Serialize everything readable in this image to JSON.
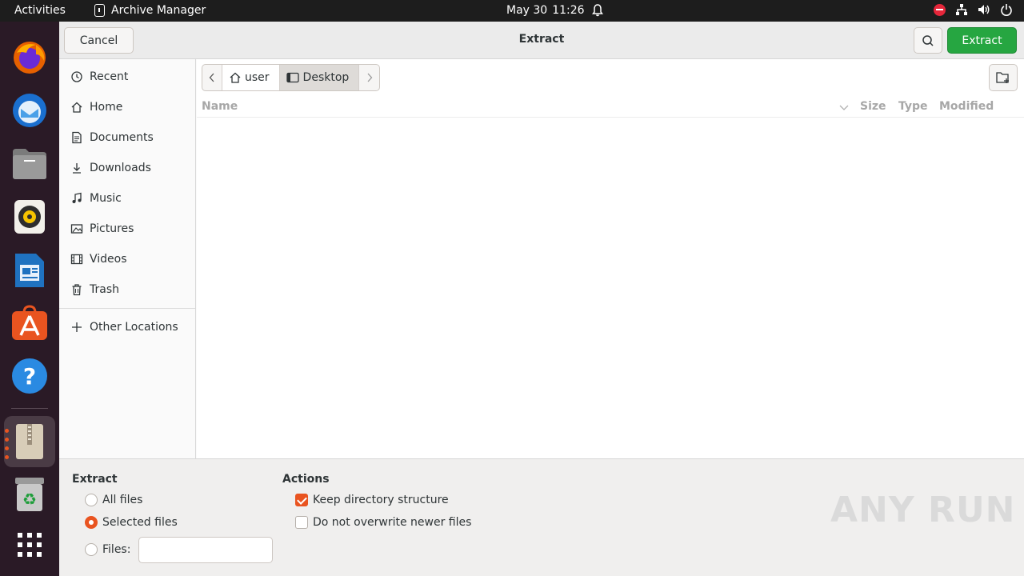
{
  "topbar": {
    "activities": "Activities",
    "app_name": "Archive Manager",
    "date": "May 30",
    "time": "11:26"
  },
  "dock": {
    "apps": [
      "firefox-icon",
      "thunderbird-icon",
      "files-icon",
      "rhythmbox-icon",
      "libreoffice-writer-icon",
      "app-center-icon",
      "help-icon",
      "archive-manager-icon",
      "trash-icon",
      "show-apps-icon"
    ],
    "active_app": "archive-manager-icon"
  },
  "dialog": {
    "title": "Extract",
    "cancel_label": "Cancel",
    "extract_label": "Extract"
  },
  "sidebar": {
    "items": [
      {
        "label": "Recent"
      },
      {
        "label": "Home"
      },
      {
        "label": "Documents"
      },
      {
        "label": "Downloads"
      },
      {
        "label": "Music"
      },
      {
        "label": "Pictures"
      },
      {
        "label": "Videos"
      },
      {
        "label": "Trash"
      }
    ],
    "other_locations": "Other Locations"
  },
  "pathbar": {
    "segments": [
      "user",
      "Desktop"
    ],
    "current": "Desktop"
  },
  "columns": {
    "name": "Name",
    "size": "Size",
    "type": "Type",
    "modified": "Modified"
  },
  "options": {
    "extract_title": "Extract",
    "all_files": "All files",
    "selected_files": "Selected files",
    "files_label": "Files:",
    "files_value": "",
    "selected_radio": "Selected files",
    "actions_title": "Actions",
    "keep_structure": "Keep directory structure",
    "keep_structure_checked": true,
    "no_overwrite": "Do not overwrite newer files",
    "no_overwrite_checked": false
  },
  "watermark": "ANY RUN",
  "colors": {
    "accent": "#e95420",
    "extract_button": "#26a641",
    "dock_bg": "#2a1a26"
  }
}
